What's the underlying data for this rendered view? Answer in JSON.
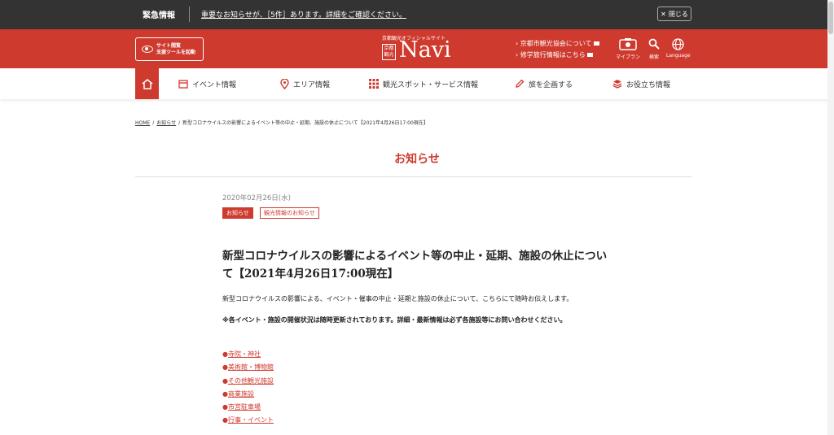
{
  "emergency": {
    "label": "緊急情報",
    "message": "重要なお知らせが、［5件］あります。詳細をご確認ください。",
    "close_label": "閉じる"
  },
  "header": {
    "support_button": [
      "サイト閲覧",
      "支援ツールを起動"
    ],
    "logo": {
      "subtitle": "京都観光オフィシャルサイト",
      "box_text": [
        "京都",
        "観光"
      ],
      "name": "Navi"
    },
    "links": [
      "京都市観光協会について",
      "修学旅行情報はこちら"
    ],
    "icons": [
      {
        "label": "マイプラン",
        "icon": "myplan-icon"
      },
      {
        "label": "検索",
        "icon": "search-icon"
      },
      {
        "label": "Language",
        "icon": "globe-icon"
      }
    ]
  },
  "nav": {
    "items": [
      {
        "label": "イベント情報",
        "icon": "calendar-icon"
      },
      {
        "label": "エリア情報",
        "icon": "map-pin-icon"
      },
      {
        "label": "観光スポット・サービス情報",
        "icon": "grid-icon"
      },
      {
        "label": "旅を企画する",
        "icon": "pencil-icon"
      },
      {
        "label": "お役立ち情報",
        "icon": "stack-icon"
      }
    ]
  },
  "breadcrumb": {
    "home": "HOME",
    "news": "お知らせ",
    "current": "新型コロナウイルスの影響によるイベント等の中止・延期、施設の休止について【2021年4月26日17:00現在】"
  },
  "page": {
    "title": "お知らせ"
  },
  "article": {
    "date": "2020年02月26日(水)",
    "tags": [
      "お知らせ",
      "観光情報のお知らせ"
    ],
    "title": "新型コロナウイルスの影響によるイベント等の中止・延期、施設の休止について【2021年4月26日17:00現在】",
    "body": "新型コロナウイルスの影響による、イベント・催事の中止・延期と施設の休止について、こちらにて随時お伝えします。",
    "notice": "※各イベント・施設の開催状況は随時更新されております。詳細・最新情報は必ず各施設等にお問い合わせください。",
    "bullet": "●",
    "links": [
      "寺院・神社",
      "美術館・博物館",
      "その他観光施設",
      "商業施設",
      "市営駐車場",
      "行事・イベント"
    ]
  },
  "colors": {
    "brand_red": "#cf3a2e",
    "emergency_bg": "#333333"
  }
}
